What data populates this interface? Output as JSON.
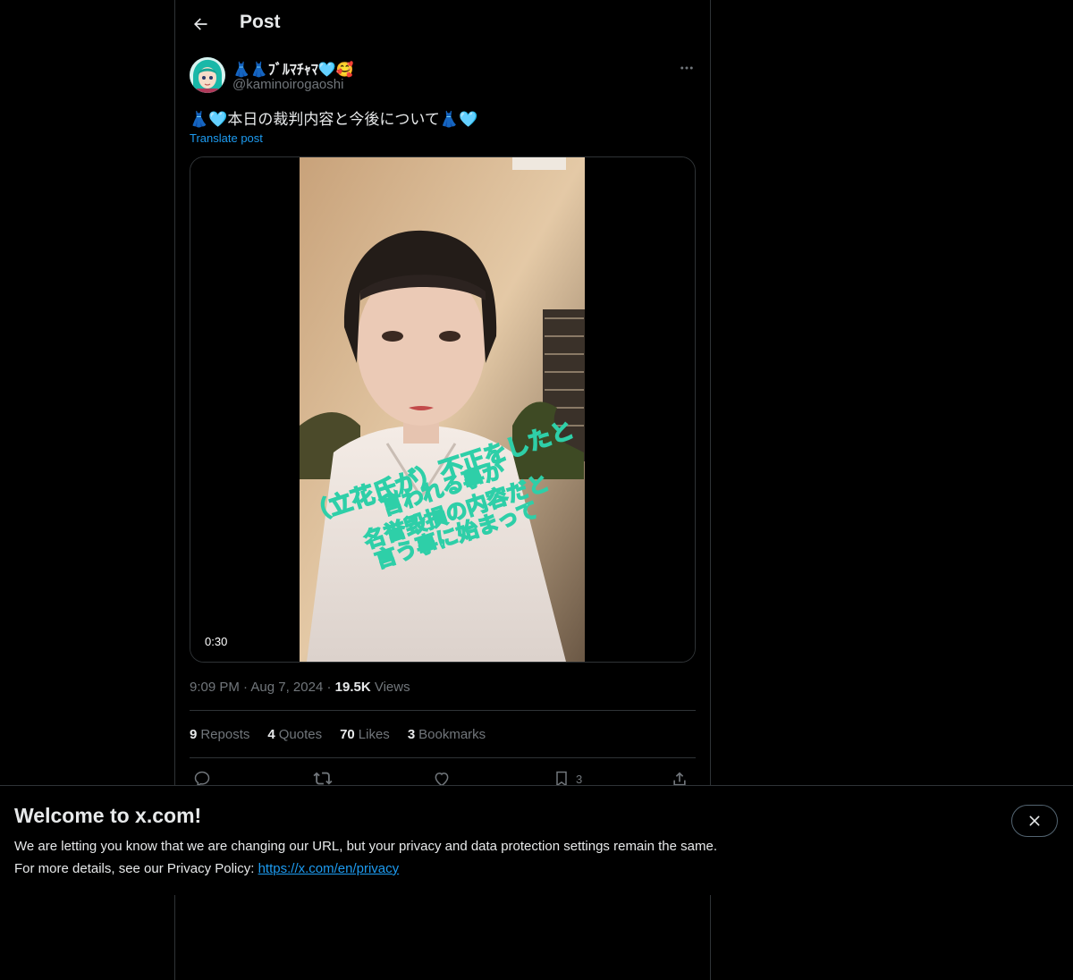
{
  "header": {
    "title": "Post"
  },
  "author": {
    "display_name": "👗👗ﾌﾞﾙﾏﾁｬﾏ🩵🥰",
    "handle": "@kaminoirogaoshi"
  },
  "post": {
    "text": "👗🩵本日の裁判内容と今後について👗🩵",
    "translate_label": "Translate post",
    "video": {
      "duration": "0:30",
      "caption_lines": [
        "（立花氏が）不正をしたと",
        "言われる事が",
        "名誉毀損の内容だと",
        "言う事に始まって"
      ]
    },
    "time": "9:09 PM",
    "date": "Aug 7, 2024",
    "views_count": "19.5K",
    "views_label": "Views"
  },
  "stats": {
    "reposts": {
      "count": "9",
      "label": "Reposts"
    },
    "quotes": {
      "count": "4",
      "label": "Quotes"
    },
    "likes": {
      "count": "70",
      "label": "Likes"
    },
    "bookmarks": {
      "count": "3",
      "label": "Bookmarks"
    }
  },
  "actions": {
    "bookmark_count": "3"
  },
  "banner": {
    "title": "Welcome to x.com!",
    "line1": "We are letting you know that we are changing our URL, but your privacy and data protection settings remain the same.",
    "line2_prefix": "For more details, see our Privacy Policy: ",
    "link": "https://x.com/en/privacy"
  },
  "colors": {
    "background": "#000000",
    "text_primary": "#e7e9ea",
    "text_secondary": "#71767b",
    "accent": "#1d9bf0",
    "border": "#2f3336",
    "caption_stroke": "#2ecfa8"
  }
}
